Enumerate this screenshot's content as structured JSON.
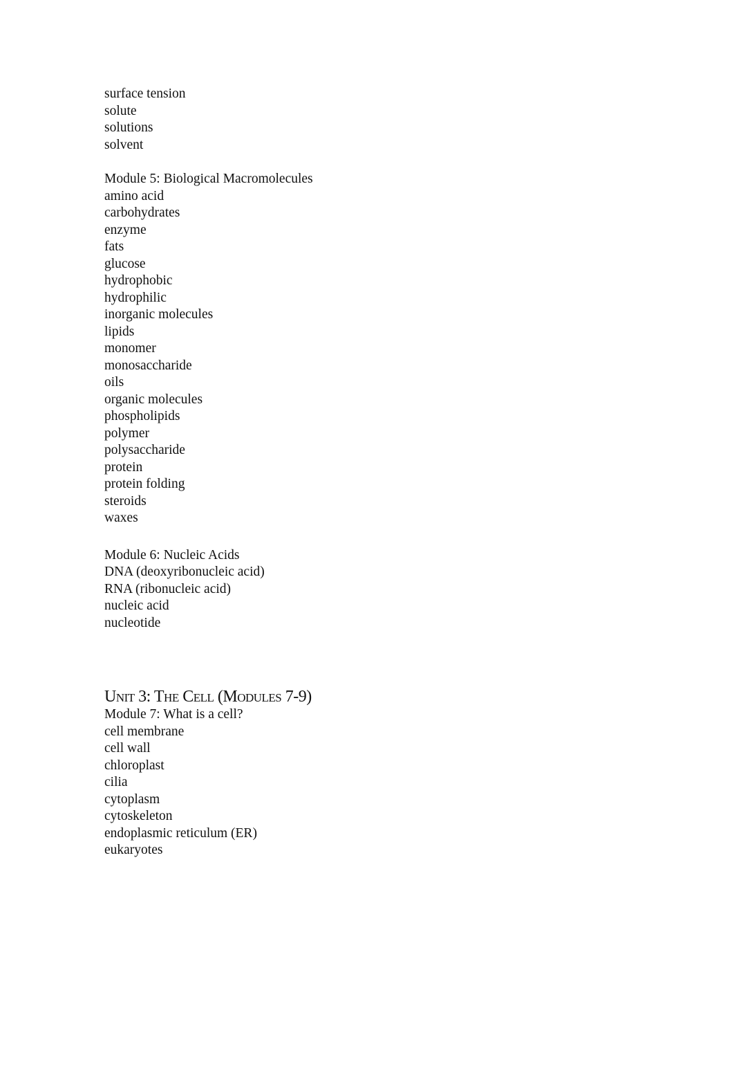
{
  "sections": [
    {
      "items": [
        "surface tension",
        "solute",
        "solutions",
        "solvent"
      ]
    },
    {
      "heading": "Module 5: Biological Macromolecules",
      "items": [
        "amino acid",
        "carbohydrates",
        "enzyme",
        "fats",
        "glucose",
        "hydrophobic",
        "hydrophilic",
        "inorganic molecules",
        "lipids",
        "monomer",
        "monosaccharide",
        "oils",
        "organic molecules",
        "phospholipids",
        "polymer",
        "polysaccharide",
        "protein",
        "protein folding",
        "steroids",
        "waxes"
      ]
    },
    {
      "heading": "Module 6: Nucleic Acids",
      "items": [
        "DNA (deoxyribonucleic acid)",
        "RNA (ribonucleic acid)",
        "nucleic acid",
        "nucleotide"
      ]
    },
    {
      "unit_heading": "Unit 3: The Cell (Modules 7-9)",
      "heading": "Module 7: What is a cell?",
      "items": [
        "cell membrane",
        "cell wall",
        "chloroplast",
        "cilia",
        "cytoplasm",
        "cytoskeleton",
        "endoplasmic reticulum (ER)",
        "eukaryotes"
      ]
    }
  ]
}
